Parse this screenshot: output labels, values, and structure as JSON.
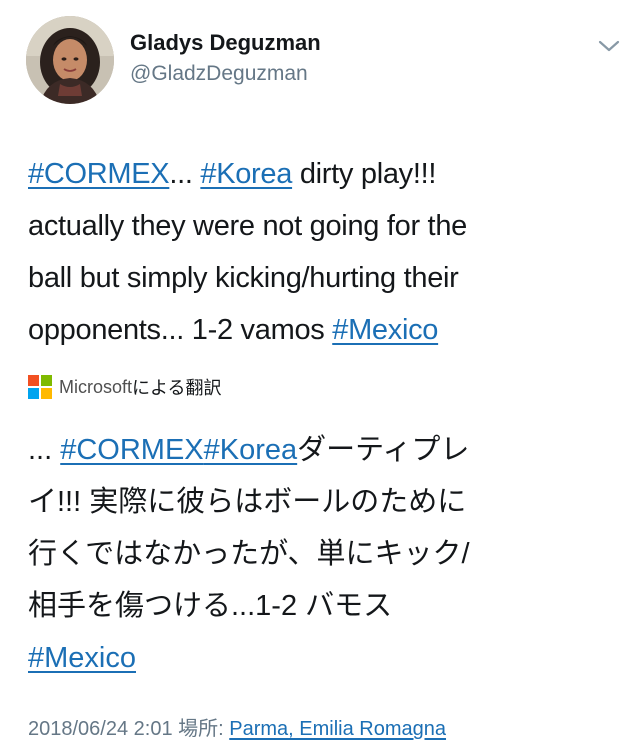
{
  "user": {
    "display_name": "Gladys Deguzman",
    "handle": "@GladzDeguzman",
    "avatar": "profile-photo"
  },
  "tweet": {
    "lines": [
      {
        "tag1": "#CORMEX",
        "mid1": "... ",
        "tag2": "#Korea",
        "rest": " dirty play!!!"
      },
      {
        "text": "actually they were not going for the"
      },
      {
        "text": "ball but simply kicking/hurting their"
      },
      {
        "text": "opponents... 1-2 vamos ",
        "tag": "#Mexico"
      }
    ]
  },
  "translation": {
    "provider": "Microsoft",
    "label_suffix": "による翻訳",
    "lines": [
      {
        "lead": "... ",
        "tag1": "#CORMEX",
        "tag2": "#Korea",
        "rest": "ダーティプレ"
      },
      {
        "text": "イ!!! 実際に彼らはボールのために"
      },
      {
        "text": "行くではなかったが、単にキック/"
      },
      {
        "text": "相手を傷つける...1-2 バモス"
      },
      {
        "tag": "#Mexico"
      }
    ]
  },
  "meta": {
    "timestamp": "2018/06/24 2:01",
    "location_label": " 場所: ",
    "location": "Parma, Emilia Romagna"
  },
  "icons": {
    "menu": "chevron-down-icon",
    "translator": "microsoft-logo-icon"
  },
  "colors": {
    "link": "#1b6fb5",
    "muted": "#657786",
    "text": "#14171a"
  }
}
